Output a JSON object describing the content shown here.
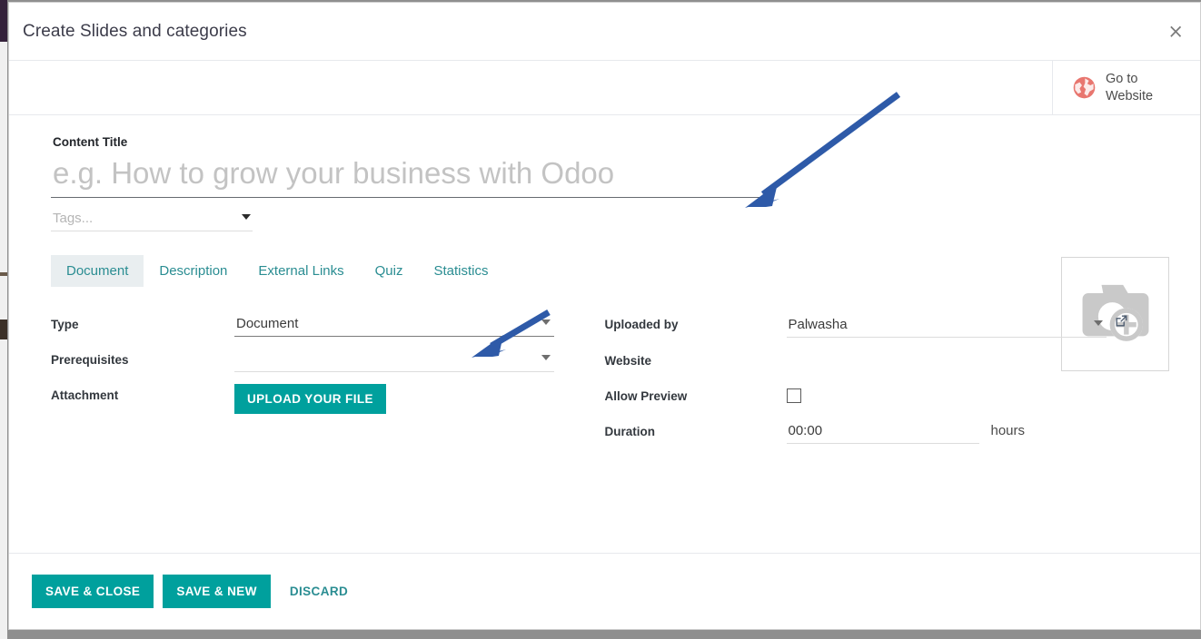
{
  "window": {
    "title": "Create Slides and categories",
    "close_icon": "close-icon",
    "close_glyph": "×"
  },
  "statbar": {
    "buttons": [
      {
        "label": "Go to Website",
        "icon": "globe-icon"
      }
    ]
  },
  "form": {
    "content_title_label": "Content Title",
    "content_title_value": "",
    "content_title_placeholder": "e.g. How to grow your business with Odoo",
    "tags_value": "",
    "tags_placeholder": "Tags...",
    "image_placeholder_icon": "camera-add-icon"
  },
  "tabs": [
    {
      "label": "Document",
      "active": true
    },
    {
      "label": "Description",
      "active": false
    },
    {
      "label": "External Links",
      "active": false
    },
    {
      "label": "Quiz",
      "active": false
    },
    {
      "label": "Statistics",
      "active": false
    }
  ],
  "fields": {
    "type": {
      "label": "Type",
      "value": "Document"
    },
    "prerequisites": {
      "label": "Prerequisites",
      "value": ""
    },
    "attachment": {
      "label": "Attachment",
      "button_label": "Upload your file"
    },
    "uploaded_by": {
      "label": "Uploaded by",
      "value": "Palwasha",
      "ext_icon": "external-link-icon"
    },
    "website": {
      "label": "Website",
      "value": ""
    },
    "allow_preview": {
      "label": "Allow Preview",
      "checked": false
    },
    "duration": {
      "label": "Duration",
      "value": "00:00",
      "suffix": "hours"
    }
  },
  "footer": {
    "save_close_label": "Save & Close",
    "save_new_label": "Save & New",
    "discard_label": "Discard"
  },
  "annotations": {
    "arrow_1": "arrow-pointing-to-content-title",
    "arrow_2": "arrow-pointing-to-type-field"
  },
  "colors": {
    "accent_teal": "#00a09d",
    "tab_teal": "#2a8d92",
    "globe_red": "#e8766f",
    "annotation_blue": "#2e5aa8",
    "backdrop": "#8f8f8f"
  }
}
